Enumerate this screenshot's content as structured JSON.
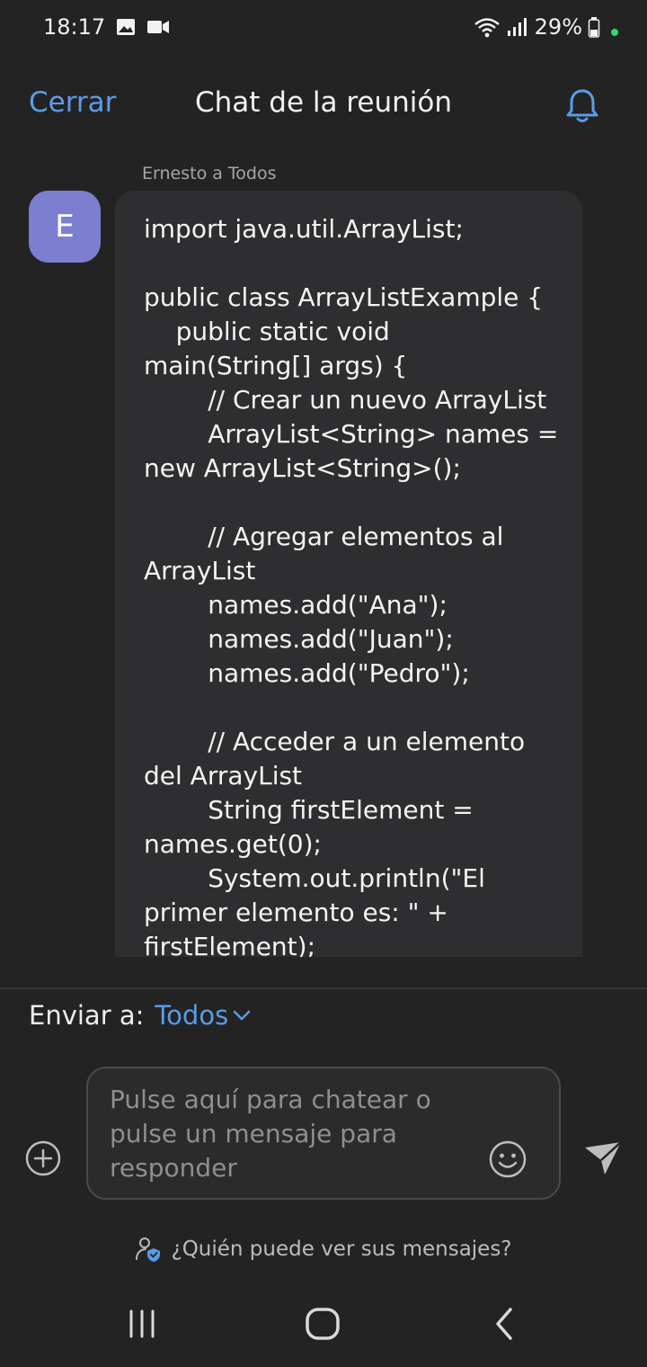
{
  "status_bar": {
    "time": "18:17",
    "battery": "29%"
  },
  "header": {
    "close_label": "Cerrar",
    "title": "Chat de la reunión"
  },
  "message": {
    "sender_line": "Ernesto a Todos",
    "avatar_initial": "E",
    "code": "import java.util.ArrayList;\n\npublic class ArrayListExample {\n    public static void main(String[] args) {\n        // Crear un nuevo ArrayList\n        ArrayList<String> names = new ArrayList<String>();\n\n        // Agregar elementos al ArrayList\n        names.add(\"Ana\");\n        names.add(\"Juan\");\n        names.add(\"Pedro\");\n\n        // Acceder a un elemento del ArrayList\n        String firstElement = names.get(0);\n        System.out.println(\"El primer elemento es: \" + firstElement);"
  },
  "send_to": {
    "label": "Enviar a:",
    "target": "Todos"
  },
  "compose": {
    "placeholder": "Pulse aquí para chatear o pulse un mensaje para responder"
  },
  "privacy_link": "¿Quién puede ver sus mensajes?",
  "colors": {
    "accent": "#5b9be8",
    "avatar": "#7c7fd0",
    "background": "#232323",
    "bubble": "#2e2e30"
  }
}
